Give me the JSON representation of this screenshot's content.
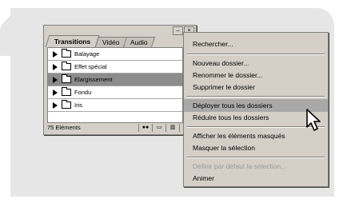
{
  "panel": {
    "tabs": [
      "Transitions",
      "Vidéo",
      "Audio"
    ],
    "window_controls": [
      "minimize-icon",
      "close-icon"
    ],
    "items": [
      {
        "label": "Balayage",
        "selected": false
      },
      {
        "label": "Effet spécial",
        "selected": false
      },
      {
        "label": "Elargissement",
        "selected": true
      },
      {
        "label": "Fondu",
        "selected": false
      },
      {
        "label": "Iris",
        "selected": false
      }
    ],
    "status_count": "75 Eléments"
  },
  "menu": {
    "items": {
      "rechercher": "Rechercher...",
      "nouveau": "Nouveau dossier...",
      "renommer": "Renommer le dossier...",
      "supprimer": "Supprimer le dossier",
      "deployer": "Déployer tous les dossiers",
      "reduire": "Réduire tous les dossiers",
      "afficher": "Afficher les éléments masqués",
      "masquer": "Masquer la sélection",
      "definir": "Définir par défaut la sélection...",
      "animer": "Animer"
    }
  },
  "colors": {
    "highlight": "#a9a9a9",
    "window": "#d4d0c8",
    "background": "#e6e6e6"
  }
}
